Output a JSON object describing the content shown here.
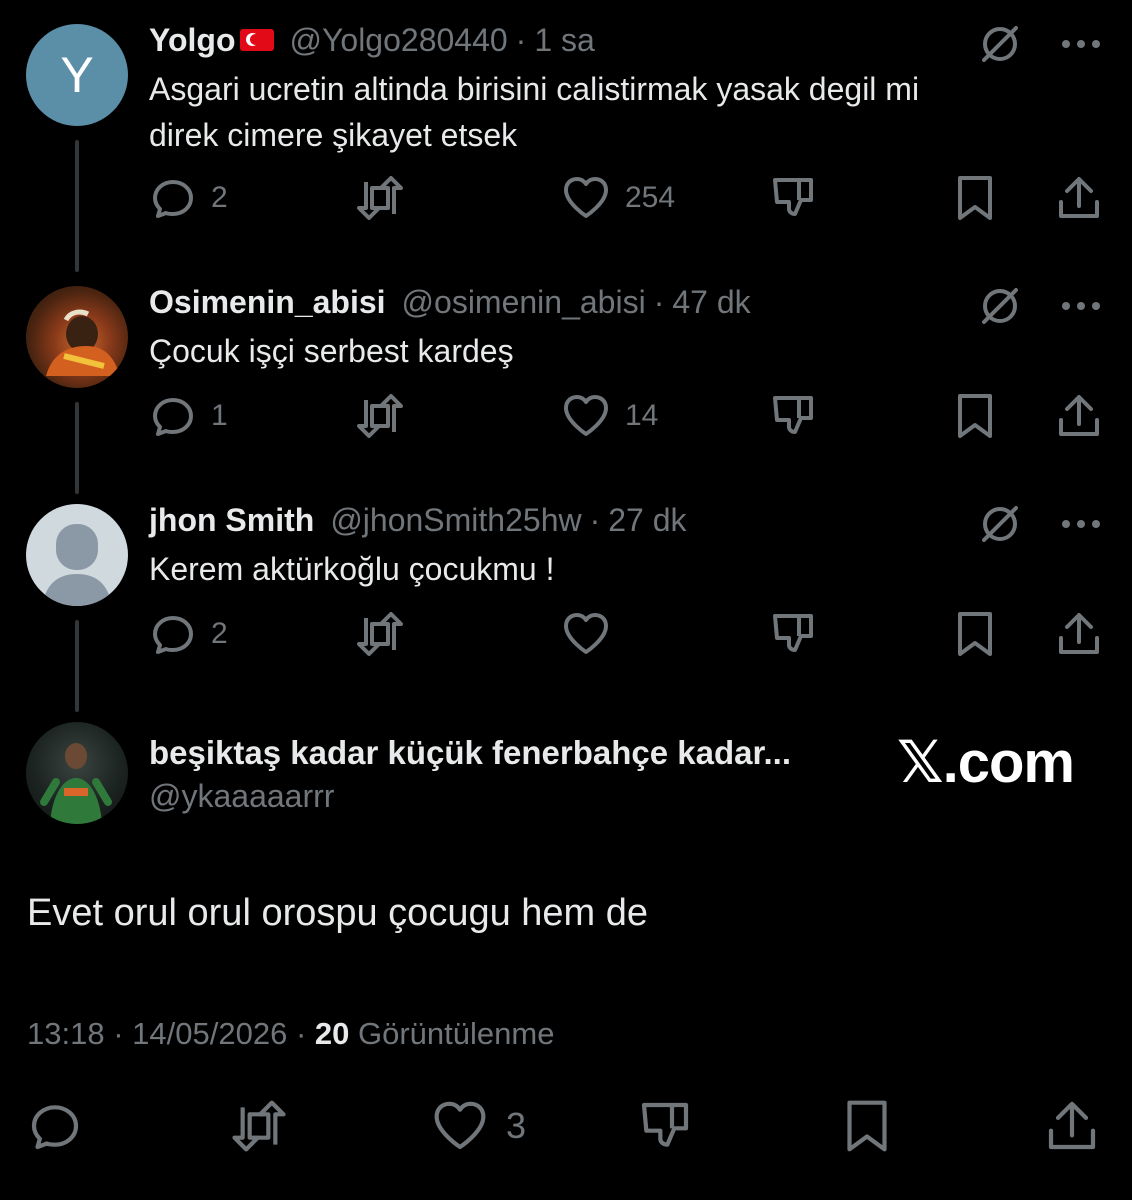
{
  "replies": [
    {
      "avatar_letter": "Y",
      "avatar_color": "#5b8fa8",
      "name": "Yolgo",
      "flag": "turkey-flag",
      "handle": "@Yolgo280440",
      "separator": "·",
      "time": "1 sa",
      "text_lines": [
        "Asgari ucretin altinda birisini calistirmak yasak degil mi",
        "direk cimere şikayet etsek"
      ],
      "replies_count": "2",
      "retweets_count": "",
      "likes_count": "254"
    },
    {
      "name": "Osimenin_abisi",
      "handle": "@osimenin_abisi",
      "separator": "·",
      "time": "47 dk",
      "text_lines": [
        "Çocuk işçi serbest kardeş"
      ],
      "replies_count": "1",
      "retweets_count": "",
      "likes_count": "14"
    },
    {
      "name": "jhon Smith",
      "handle": "@jhonSmith25hw",
      "separator": "·",
      "time": "27 dk",
      "text_lines": [
        "Kerem aktürkoğlu çocukmu !"
      ],
      "replies_count": "2",
      "retweets_count": "",
      "likes_count": ""
    }
  ],
  "main": {
    "name": "beşiktaş kadar küçük fenerbahçe kadar...",
    "handle": "@ykaaaaarrr",
    "watermark": "𝕏.com",
    "text": "Evet orul orul orospu çocugu hem de",
    "time": "13:18",
    "date": "14/05/2026",
    "separator": "·",
    "views_count": "20",
    "views_label": "Görüntülenme",
    "likes_count": "3"
  },
  "colors": {
    "background": "#000000",
    "text": "#e7e9ea",
    "muted": "#71767b",
    "thread_line": "#333639"
  }
}
